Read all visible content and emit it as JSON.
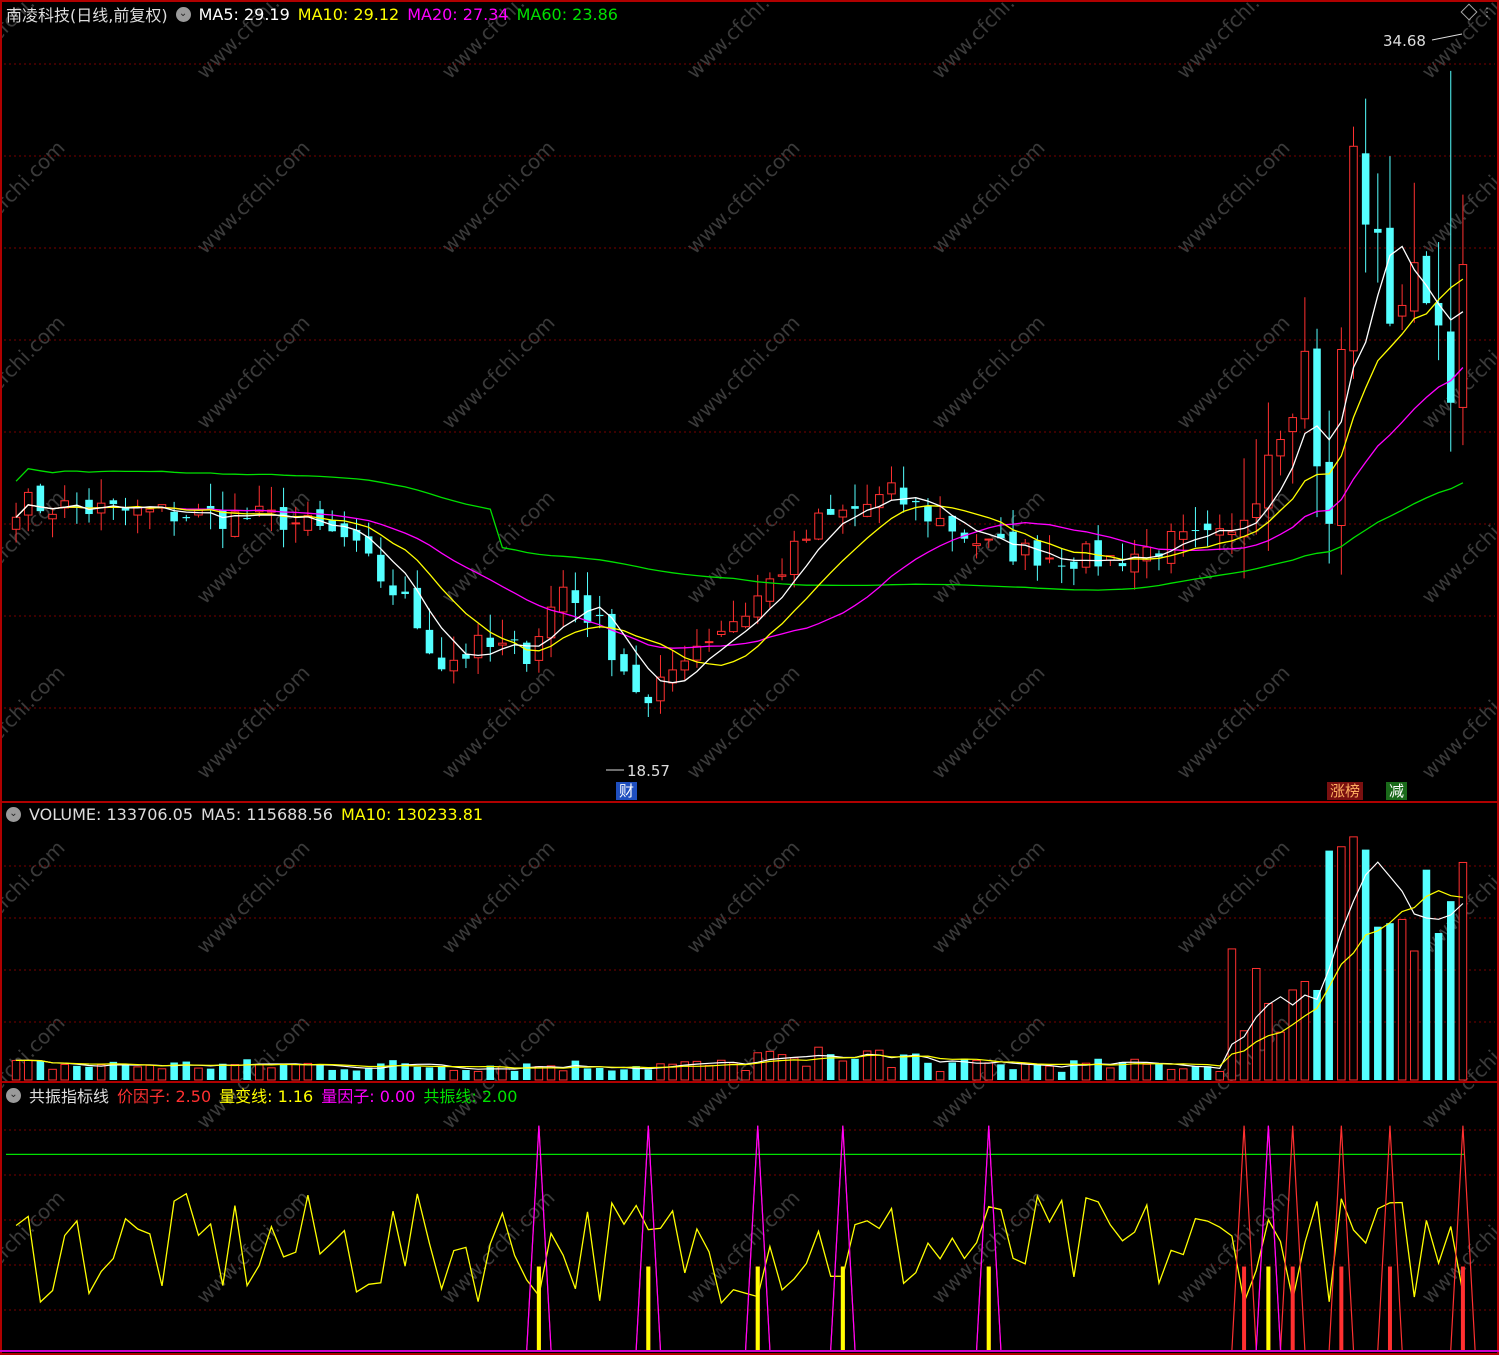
{
  "price_panel": {
    "stock_name": "南凌科技(日线,前复权)",
    "ma": [
      {
        "label": "MA5: 29.19",
        "color": "#ffffff"
      },
      {
        "label": "MA10: 29.12",
        "color": "#ffff00"
      },
      {
        "label": "MA20: 27.34",
        "color": "#ff00ff"
      },
      {
        "label": "MA60: 23.86",
        "color": "#00e000"
      }
    ],
    "high_label": "34.68",
    "low_label": "18.57",
    "tags": [
      {
        "text": "财",
        "bg": "#1f4fbf",
        "fg": "#ffffff"
      },
      {
        "text": "涨榜",
        "bg": "#7a1010",
        "fg": "#ffb060"
      },
      {
        "text": "减",
        "bg": "#1a6a1a",
        "fg": "#ffffff"
      }
    ]
  },
  "volume_panel": {
    "legend": [
      {
        "label": "VOLUME: 133706.05",
        "color": "#dddddd"
      },
      {
        "label": "MA5: 115688.56",
        "color": "#dddddd"
      },
      {
        "label": "MA10: 130233.81",
        "color": "#ffff00"
      }
    ]
  },
  "indicator_panel": {
    "name": "共振指标线",
    "legend": [
      {
        "label": "价因子: 2.50",
        "color": "#ff3030"
      },
      {
        "label": "量变线: 1.16",
        "color": "#ffff00"
      },
      {
        "label": "量因子: 0.00",
        "color": "#ff00ff"
      },
      {
        "label": "共振线: 2.00",
        "color": "#00e000"
      }
    ]
  },
  "colors": {
    "up": "#ff3030",
    "down": "#54ffff",
    "grid": "#7a0000",
    "frame": "#b00000",
    "ma5": "#ffffff",
    "ma10": "#ffff00",
    "ma20": "#ff00ff",
    "ma60": "#00e000"
  },
  "watermark": "www.cfchi.com"
}
